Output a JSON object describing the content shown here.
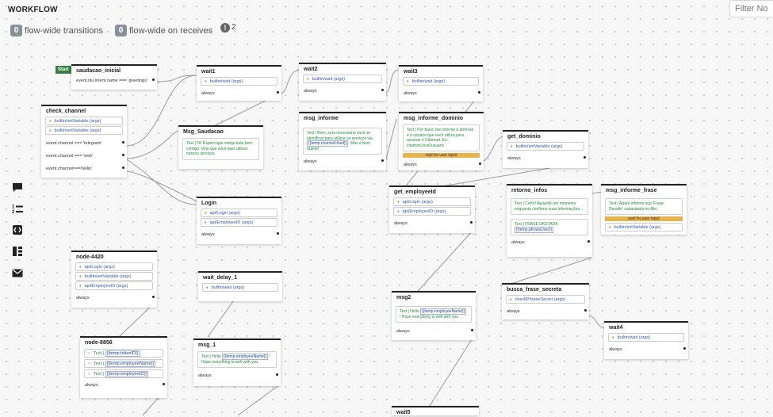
{
  "header": {
    "title": "WORKFLOW",
    "filter_placeholder": "Filter No",
    "transitions_count": "0",
    "transitions_label": "flow-wide transitions",
    "receives_count": "0",
    "receives_label": "flow-wide on receives",
    "warnings_count": "2"
  },
  "toolbar": {
    "icons": [
      "chat-bubble-icon",
      "numbered-list-icon",
      "code-bracket-icon",
      "split-flow-icon",
      "envelope-icon"
    ]
  },
  "start_label": "Start",
  "nodes": {
    "saudacao_inicial": {
      "title": "saudacao_inicial",
      "t1": "event.nlu.intent.name === 'greetings'"
    },
    "check_channel": {
      "title": "check_channel",
      "a1": "builtin/setVariable (args)",
      "a2": "builtin/setVariable (args)",
      "t1": "event.channel === 'telegram'",
      "t2": "event.channel === 'web'",
      "t3": "event.channel==='twilio'"
    },
    "wait1": {
      "title": "wait1",
      "a1": "builtin/wait (args)",
      "t1": "always"
    },
    "msg_saudacao": {
      "title": "Msg_Saudacao",
      "say": "Text | Oi! Espero que esteja tudo bem contigo. Veja que você quer utilizar nossos serviços."
    },
    "login": {
      "title": "Login",
      "a1": "api/Login (args)",
      "a2": "api/EmployeeID (args)",
      "t1": "always"
    },
    "node_4420": {
      "title": "node-4420",
      "a1": "api/Login (args)",
      "a2": "builtin/setVariable (args)",
      "a3": "api/EmployeeID (args)",
      "t1": "always"
    },
    "node_8856": {
      "title": "node-8856",
      "x1": "Text |",
      "v1": "{{temp.tokenID}}",
      "x2": "Text |",
      "v2": "{{temp.employeeName}}",
      "x3": "Text |",
      "v3": "{{temp.employeeID}}",
      "t1": "always"
    },
    "wait_delay_1": {
      "title": "wait_delay_1",
      "a1": "builtin/wait (args)"
    },
    "msg_1": {
      "title": "msg_1",
      "say_a": "Text | Hello",
      "say_v": "{{temp.employeeName}}",
      "say_b": "! Hope everything is well with you.",
      "t1": "always"
    },
    "wait2": {
      "title": "wait2",
      "a1": "builtin/wait (args)",
      "t1": "always"
    },
    "msg_informe": {
      "title": "msg_informe",
      "say_a": "Text | Bom, será necessário você se identificar para utilizar os serviços via",
      "say_v": "{{temp.channelUsed}}",
      "say_b": ". Mas é bem rápido!",
      "t1": "always"
    },
    "wait3": {
      "title": "wait3",
      "a1": "builtin/wait (args)",
      "t1": "always"
    },
    "msg_informe_dominio": {
      "title": "msg_informe_dominio",
      "say": "Text | Por favor, me informe o domínio e o usuário que você utiliza para acessar o Citamart. Ex: citamart.local\\usuario",
      "input": "wait for user input",
      "t1": "always"
    },
    "get_dominio": {
      "title": "get_dominio",
      "a1": "builtin/setVariable (args)",
      "t1": "always"
    },
    "get_employeeid": {
      "title": "get_employeeId",
      "a1": "api/Login (args)",
      "a2": "api/EmployeeID (args)",
      "t1": "always"
    },
    "retorno_infos": {
      "title": "retorno_infos",
      "say1": "Text | Certo! Aguarde um momento enquanto confirmo suas informações...",
      "say2_a": "Text | FRASE DIGITADA:",
      "say2_v": "{{temp.phraseUser}}",
      "t1": "always"
    },
    "msg_informe_frase": {
      "title": "msg_informe_frase",
      "say": "Text | Agora informe sua 'Frase Desafio' cadastrada no Abc.",
      "input": "wait for user input",
      "a1": "builtin/setVariable (args)"
    },
    "busca_frase_secreta": {
      "title": "busca_frase_secreta",
      "a1": "checkPhraseSecret (args)",
      "t1": "always"
    },
    "msg2": {
      "title": "msg2",
      "say_a": "Text | Hello",
      "say_v": "{{temp.employeeName}}",
      "say_b": "! Hope everything is well with you.",
      "t1": "always"
    },
    "wait4": {
      "title": "wait4",
      "a1": "builtin/wait (args)",
      "t1": "always"
    },
    "wait5": {
      "title": "wait5"
    }
  }
}
